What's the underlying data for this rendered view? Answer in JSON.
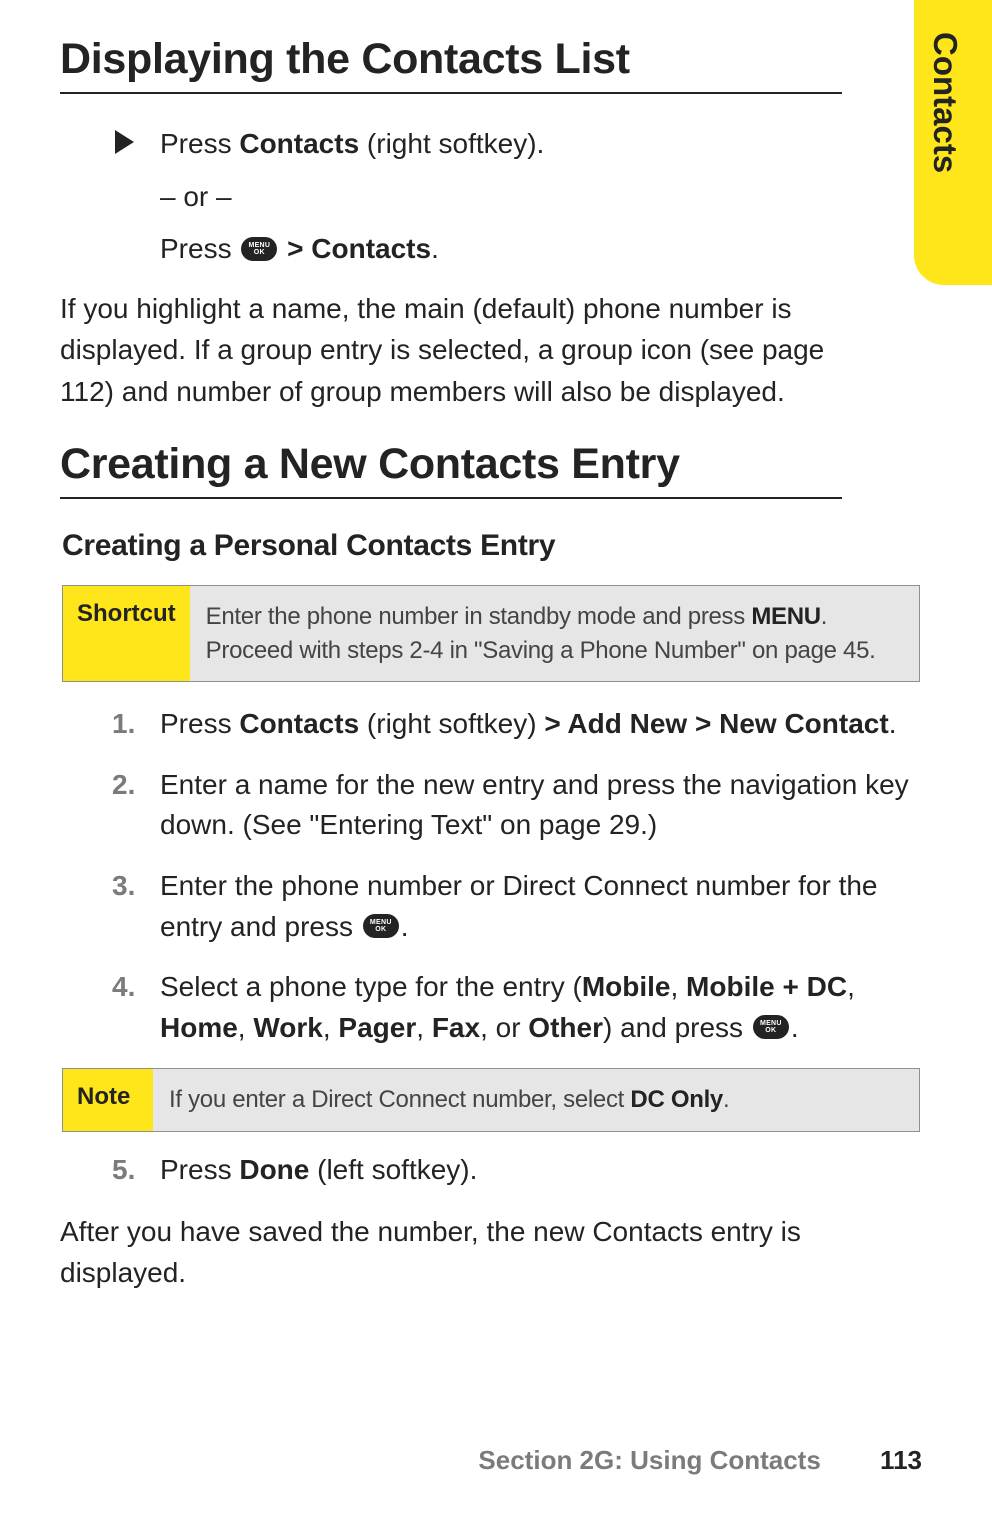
{
  "side_tab": "Contacts",
  "h1a": "Displaying the Contacts List",
  "bullet": {
    "line1_pre": "Press ",
    "line1_b": "Contacts",
    "line1_post": " (right softkey).",
    "or": "– or –",
    "line2_pre": "Press ",
    "line2_gt": " > ",
    "line2_b": "Contacts",
    "line2_post": "."
  },
  "para1": "If you highlight a name, the main (default) phone number is displayed. If a group entry is selected, a group icon (see page 112) and number of group members will also be displayed.",
  "h1b": "Creating a New Contacts Entry",
  "h2": "Creating a Personal Contacts Entry",
  "shortcut": {
    "label": "Shortcut",
    "text_pre": "Enter the phone number in standby mode and press ",
    "text_b": "MENU",
    "text_post": ". Proceed with steps 2-4 in \"Saving a Phone Number\" on page 45."
  },
  "steps": {
    "s1_pre": "Press ",
    "s1_b1": "Contacts",
    "s1_mid": " (right softkey) ",
    "s1_b2": "> Add New > New Contact",
    "s1_post": ".",
    "s2": "Enter a name for the new entry and press the navigation key down. (See \"Entering Text\" on page 29.)",
    "s3_pre": "Enter the phone number or Direct Connect number for the entry and press ",
    "s3_post": ".",
    "s4_pre": "Select a phone type for the entry (",
    "s4_b1": "Mobile",
    "s4_c1": ", ",
    "s4_b2": "Mobile + DC",
    "s4_c2": ", ",
    "s4_b3": "Home",
    "s4_c3": ", ",
    "s4_b4": "Work",
    "s4_c4": ", ",
    "s4_b5": "Pager",
    "s4_c5": ", ",
    "s4_b6": "Fax",
    "s4_c6": ", or ",
    "s4_b7": "Other",
    "s4_mid": ") and press ",
    "s4_post": ".",
    "s5_pre": "Press ",
    "s5_b": "Done",
    "s5_post": " (left softkey)."
  },
  "note": {
    "label": "Note",
    "text_pre": "If you enter a Direct Connect number, select ",
    "text_b": "DC Only",
    "text_post": "."
  },
  "para2": "After you have saved the number, the new Contacts entry is displayed.",
  "footer": {
    "section": "Section 2G: Using Contacts",
    "page": "113"
  },
  "icon": {
    "top": "MENU",
    "bottom": "OK"
  }
}
